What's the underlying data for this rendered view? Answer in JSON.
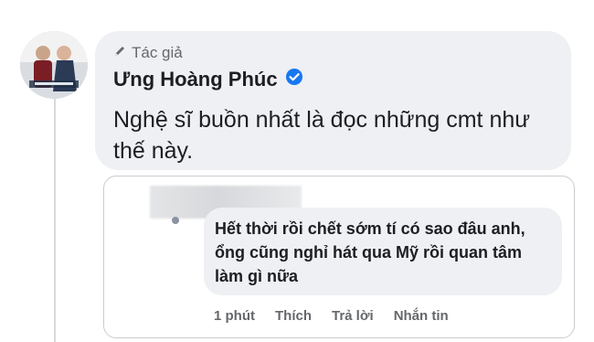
{
  "post_comment": {
    "author_badge": "Tác giả",
    "author_name": "Ưng Hoàng Phúc",
    "text": "Nghệ sĩ buồn nhất là đọc những cmt như thế này."
  },
  "reply": {
    "text": "Hết thời rồi chết sớm tí có sao đâu anh, ổng cũng nghỉ hát qua Mỹ rồi quan tâm làm gì nữa",
    "time": "1 phút",
    "like_label": "Thích",
    "reply_label": "Trả lời",
    "message_label": "Nhắn tin"
  },
  "colors": {
    "bubble_bg": "#eef0f3",
    "verified_blue": "#1877f2",
    "muted_text": "#65676b"
  }
}
